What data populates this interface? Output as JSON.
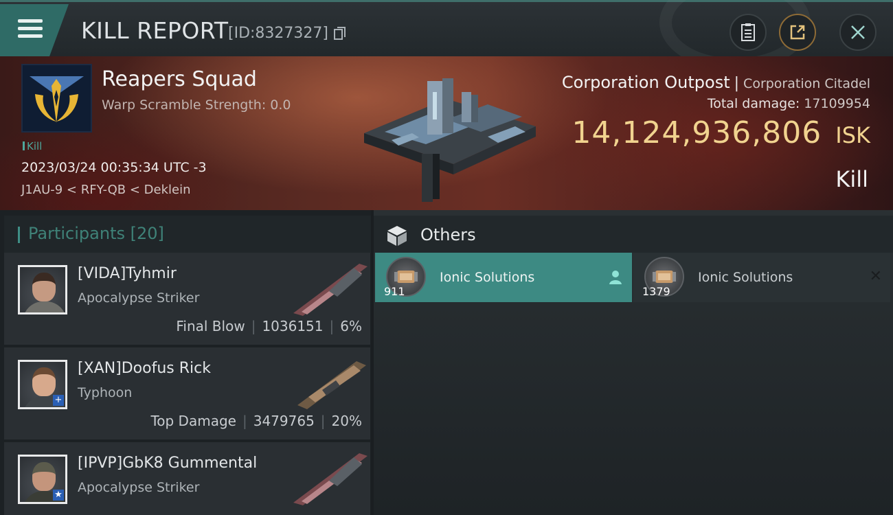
{
  "window": {
    "title": "KILL REPORT",
    "report_id": "[ID:8327327]",
    "icons": [
      "menu-icon",
      "copy-icon",
      "clipboard-icon",
      "share-icon",
      "close-icon"
    ]
  },
  "victim": {
    "corp_name": "Reapers Squad",
    "warp_scramble": "Warp Scramble Strength: 0.0",
    "tag": "Kill",
    "timestamp": "2023/03/24 00:35:34 UTC -3",
    "location": "J1AU-9 < RFY-QB < Deklein"
  },
  "target": {
    "name": "Corporation Outpost",
    "separator": "|",
    "class": "Corporation Citadel",
    "total_damage_label": "Total damage:",
    "total_damage_value": "17109954",
    "isk_value": "14,124,936,806",
    "isk_unit": "ISK",
    "result": "Kill"
  },
  "participants": {
    "header": "Participants [20]",
    "items": [
      {
        "name": "[VIDA]Tyhmir",
        "ship": "Apocalypse Striker",
        "role": "Final Blow",
        "damage": "1036151",
        "percent": "6%"
      },
      {
        "name": "[XAN]Doofus Rick",
        "ship": "Typhoon",
        "role": "Top Damage",
        "damage": "3479765",
        "percent": "20%"
      },
      {
        "name": "[IPVP]GbK8 Gummental",
        "ship": "Apocalypse Striker"
      }
    ]
  },
  "others": {
    "header": "Others",
    "items": [
      {
        "name": "Ionic Solutions",
        "qty": "911",
        "selected": true
      },
      {
        "name": "Ionic Solutions",
        "qty": "1379",
        "selected": false
      }
    ]
  },
  "colors": {
    "accent_teal": "#3d8a83",
    "isk_gold": "#f1d38f",
    "banner_red": "#5a2a22"
  }
}
